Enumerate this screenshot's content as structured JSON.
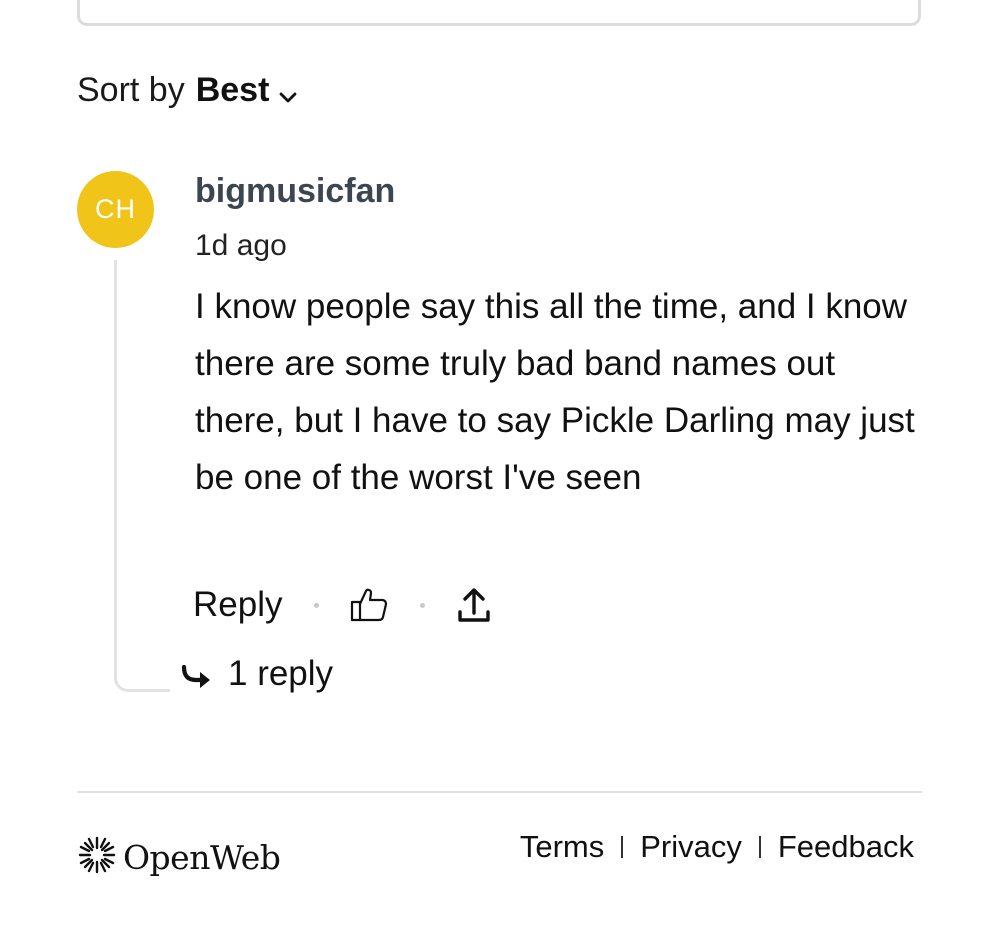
{
  "sort": {
    "prefix": "Sort by",
    "value": "Best",
    "icon": "chevron-down-icon"
  },
  "comment": {
    "avatar_initials": "CH",
    "avatar_color": "#f0c419",
    "username": "bigmusicfan",
    "timestamp": "1d ago",
    "body": "I know people say this all the time, and I know there are some truly bad band names out there, but I have to say Pickle Darling may just be one of the worst I've seen",
    "actions": {
      "reply_label": "Reply",
      "like_icon": "thumbs-up-icon",
      "share_icon": "share-icon"
    },
    "replies_label": "1 reply",
    "replies_icon": "reply-arrow-icon"
  },
  "footer": {
    "brand": "OpenWeb",
    "brand_icon": "openweb-logo-icon",
    "links": [
      {
        "label": "Terms"
      },
      {
        "label": "Privacy"
      },
      {
        "label": "Feedback"
      }
    ]
  }
}
